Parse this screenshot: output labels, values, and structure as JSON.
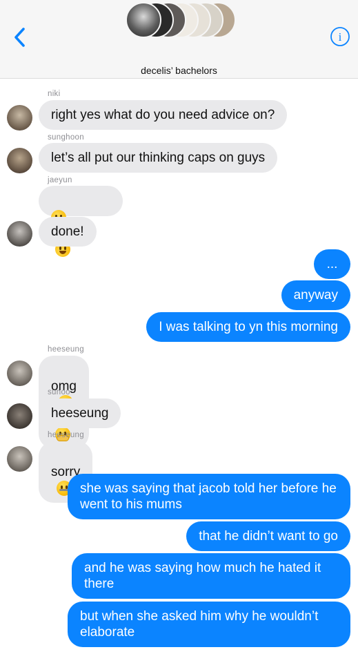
{
  "header": {
    "title": "decelis’ bachelors",
    "back_icon": "chevron-left-icon",
    "info_icon": "info-icon",
    "accent": "#0b84ff"
  },
  "messages": {
    "niki_name": "niki",
    "m1": "right yes what do you need advice on?",
    "sunghoon_name": "sunghoon",
    "m2": "let’s all put our thinking caps on guys",
    "jaeyun_name": "jaeyun",
    "m3_emojis": [
      "grinning-face",
      "hushed-face",
      "cowboy-hat-face"
    ],
    "m4": "done!",
    "o1": "...",
    "o2": "anyway",
    "o3": "I was talking to yn this morning",
    "heeseung_name": "heeseung",
    "m5": "omg",
    "m5_emojis": [
      "face-with-hand-over-mouth",
      "face-with-hand-over-mouth",
      "face-with-hand-over-mouth"
    ],
    "sunoo_name": "sunoo",
    "m6": "heeseung",
    "heeseung_name2": "heeseung",
    "m7": "sorry",
    "m7_emoji": "zipper-mouth-face",
    "o4": "she was saying that jacob told her before he went to his mums",
    "o5": "that he didn’t want to go",
    "o6": "and he was saying how much he hated it there",
    "o7": "but when she asked him why he wouldn’t elaborate"
  },
  "colors": {
    "incoming": "#e9e9eb",
    "outgoing": "#0b84ff",
    "meta": "#8e8e93"
  }
}
